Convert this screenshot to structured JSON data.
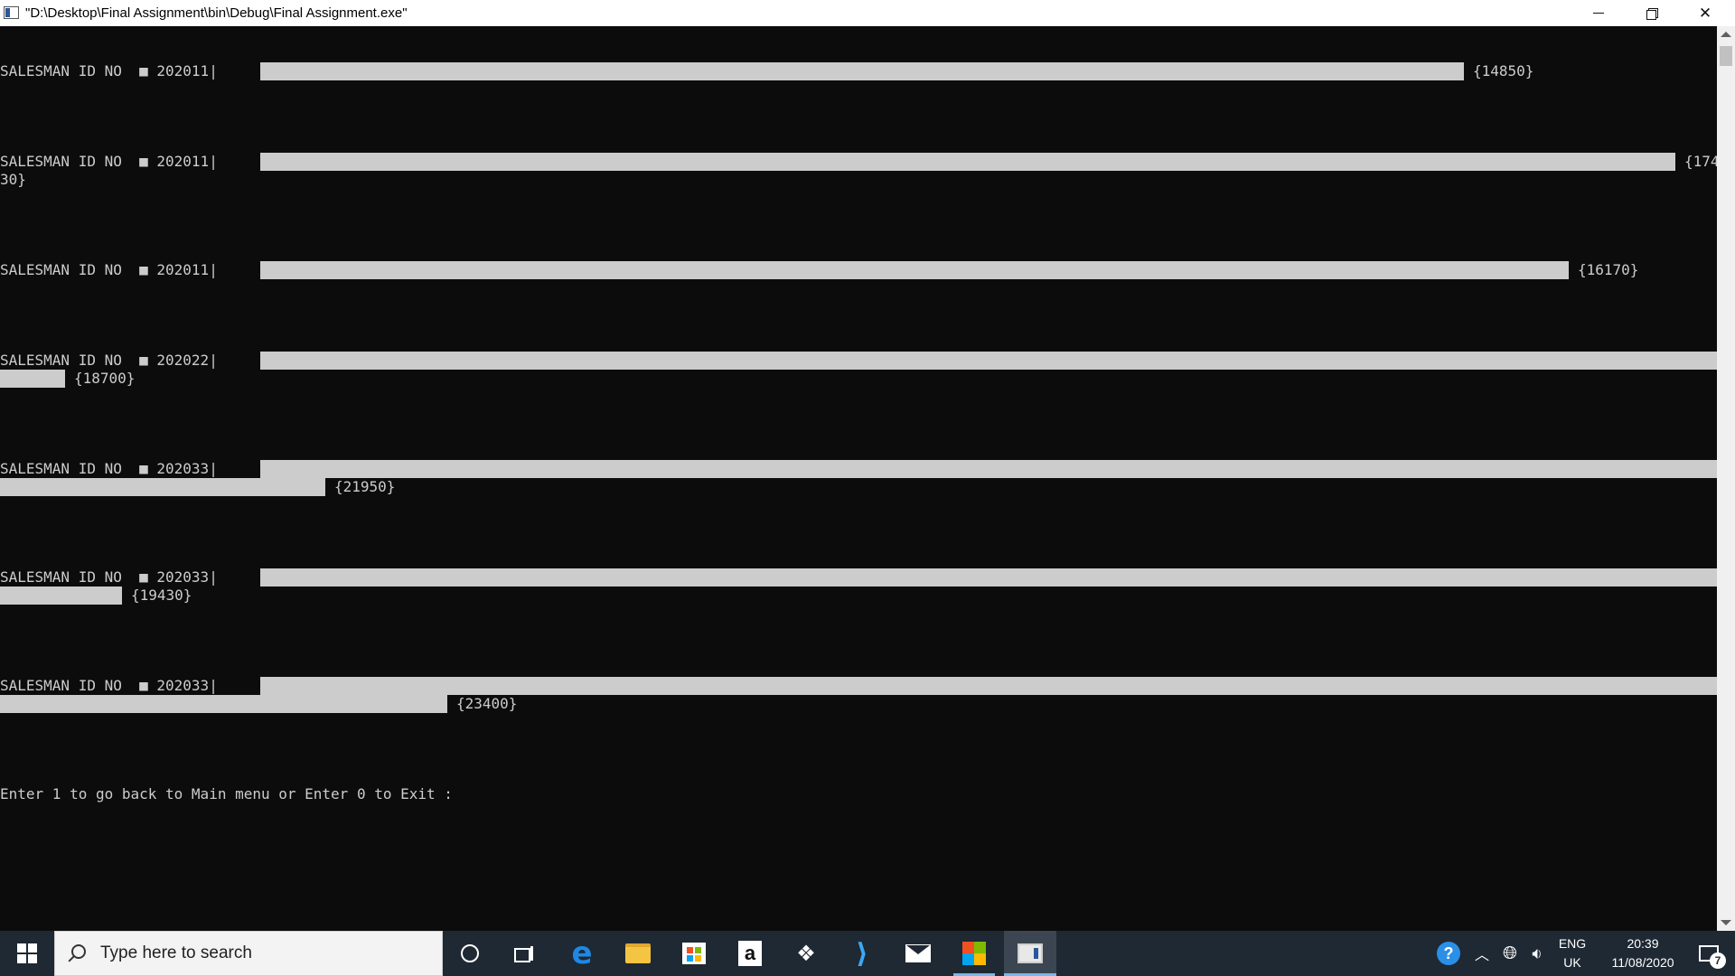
{
  "window": {
    "title": "\"D:\\Desktop\\Final Assignment\\bin\\Debug\\Final Assignment.exe\"",
    "minimize_glyph": "",
    "close_glyph": "✕"
  },
  "console": {
    "rows": [
      {
        "label": "SALESMAN ID NO  ■ 202011|",
        "value_text": "{14850}"
      },
      {
        "label": "SALESMAN ID NO  ■ 202011|",
        "value_text_a": "{174",
        "value_text_b": "30}"
      },
      {
        "label": "SALESMAN ID NO  ■ 202011|",
        "value_text": "{16170}"
      },
      {
        "label": "SALESMAN ID NO  ■ 202022|",
        "value_text": "{18700}"
      },
      {
        "label": "SALESMAN ID NO  ■ 202033|",
        "value_text": "{21950}"
      },
      {
        "label": "SALESMAN ID NO  ■ 202033|",
        "value_text": "{19430}"
      },
      {
        "label": "SALESMAN ID NO  ■ 202033|",
        "value_text": "{23400}"
      }
    ],
    "prompt": "Enter 1 to go back to Main menu or Enter 0 to Exit :"
  },
  "taskbar": {
    "search_placeholder": "Type here to search",
    "icons": [
      "windows-start-icon",
      "search-icon",
      "cortana-icon",
      "task-view-icon",
      "edge-icon",
      "file-explorer-icon",
      "store-icon",
      "amazon-icon",
      "dropbox-icon",
      "visual-studio-icon",
      "mail-icon",
      "winforms-app-icon",
      "console-app-icon"
    ],
    "amazon_letter": "a",
    "edge_letter": "e",
    "help_glyph": "?",
    "language_line1": "ENG",
    "language_line2": "UK",
    "time": "20:39",
    "date": "11/08/2020",
    "notification_count": "7"
  },
  "colors": {
    "console_bg": "#0c0c0c",
    "console_text": "#cccccc",
    "taskbar_bg": "#1f2933",
    "accent": "#76b9ed"
  }
}
